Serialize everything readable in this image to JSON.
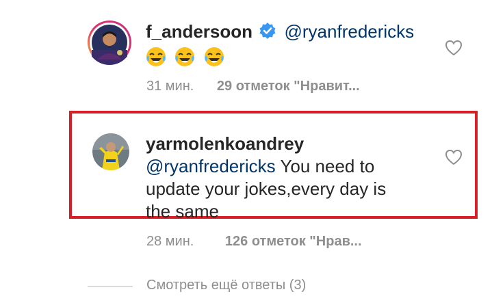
{
  "comments": [
    {
      "username": "f_andersoon",
      "verified": true,
      "mention": "@ryanfredericks",
      "emoji_count": 3,
      "emoji_name": "tears-of-joy-emoji",
      "time": "31 мин.",
      "likes": "29 отметок \"Нравит...",
      "like_icon": "heart-icon"
    },
    {
      "username": "yarmolenkoandrey",
      "mention": "@ryanfredericks",
      "text_line1": "You need to",
      "text_line2": "update your jokes,every day is",
      "text_line3": "the same",
      "time": "28 мин.",
      "likes": "126 отметок \"Нрав...",
      "like_icon": "heart-icon",
      "highlight_color": "#d81f26"
    }
  ],
  "view_more": "Смотреть ещё ответы (3)",
  "colors": {
    "mention": "#003569",
    "meta": "#8e8e8e",
    "verified": "#3897f0",
    "highlight": "#d81f26"
  }
}
